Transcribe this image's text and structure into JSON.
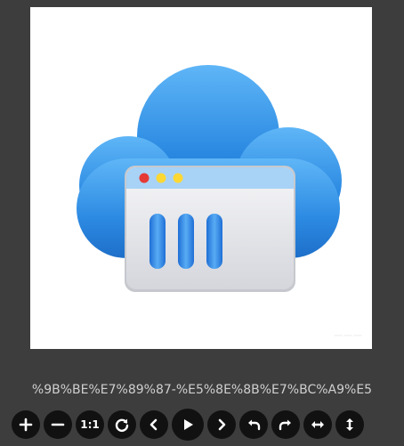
{
  "image": {
    "alt": "",
    "watermark": "一一一"
  },
  "filename": "%9B%BE%E7%89%87-%E5%8E%8B%E7%BC%A9%E5",
  "toolbar": {
    "buttons": [
      {
        "icon": "zoom-in-icon"
      },
      {
        "icon": "zoom-out-icon"
      },
      {
        "icon": "actual-size-icon",
        "label": "1:1"
      },
      {
        "icon": "reset-icon"
      },
      {
        "icon": "previous-icon"
      },
      {
        "icon": "play-icon"
      },
      {
        "icon": "next-icon"
      },
      {
        "icon": "rotate-left-icon"
      },
      {
        "icon": "rotate-right-icon"
      },
      {
        "icon": "flip-horizontal-icon"
      },
      {
        "icon": "flip-vertical-icon"
      }
    ]
  },
  "colors": {
    "background": "#3d3d3d",
    "button": "#111111",
    "cloud": "#2f8fe6",
    "window": "#ececf0",
    "dot_red": "#e53935",
    "dot_yellow": "#fdd835"
  }
}
